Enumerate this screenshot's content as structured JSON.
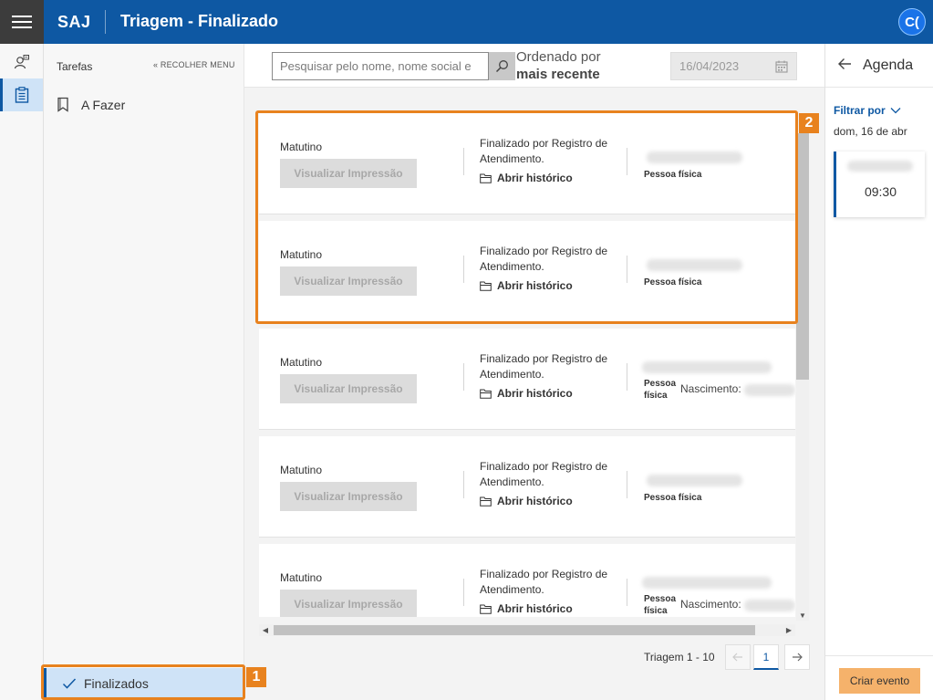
{
  "header": {
    "brand": "SAJ",
    "title": "Triagem - Finalizado",
    "user_initials": "C("
  },
  "sidebar": {
    "title": "Tarefas",
    "collapse_label": "« RECOLHER MENU",
    "items": [
      {
        "label": "A Fazer"
      },
      {
        "label": "Finalizados",
        "active": true
      }
    ]
  },
  "toolbar": {
    "search_placeholder": "Pesquisar pelo nome, nome social e",
    "order_prefix": "Ordenado por",
    "order_value": "mais recente",
    "date_value": "16/04/2023"
  },
  "records": [
    {
      "shift": "Matutino",
      "print_label": "Visualizar Impressão",
      "status": "Finalizado por Registro de Atendimento.",
      "history_label": "Abrir histórico",
      "person_type": "Pessoa física",
      "birth_label": ""
    },
    {
      "shift": "Matutino",
      "print_label": "Visualizar Impressão",
      "status": "Finalizado por Registro de Atendimento.",
      "history_label": "Abrir histórico",
      "person_type": "Pessoa física",
      "birth_label": ""
    },
    {
      "shift": "Matutino",
      "print_label": "Visualizar Impressão",
      "status": "Finalizado por Registro de Atendimento.",
      "history_label": "Abrir histórico",
      "person_type": "Pessoa física",
      "birth_label": "Nascimento:"
    },
    {
      "shift": "Matutino",
      "print_label": "Visualizar Impressão",
      "status": "Finalizado por Registro de Atendimento.",
      "history_label": "Abrir histórico",
      "person_type": "Pessoa física",
      "birth_label": ""
    },
    {
      "shift": "Matutino",
      "print_label": "Visualizar Impressão",
      "status": "Finalizado por Registro de Atendimento.",
      "history_label": "Abrir histórico",
      "person_type": "Pessoa física",
      "birth_label": "Nascimento:"
    }
  ],
  "pagination": {
    "range_label": "Triagem 1 - 10",
    "current_page": "1"
  },
  "agenda": {
    "title": "Agenda",
    "filter_label": "Filtrar por",
    "date_label": "dom, 16 de abr",
    "events": [
      {
        "time": "09:30"
      }
    ],
    "create_label": "Criar evento"
  },
  "callouts": [
    "1",
    "2"
  ],
  "colors": {
    "brand_blue": "#0e58a3",
    "callout_orange": "#e8821e",
    "active_bg": "#cfe3f7",
    "create_button": "#f5b26b"
  }
}
